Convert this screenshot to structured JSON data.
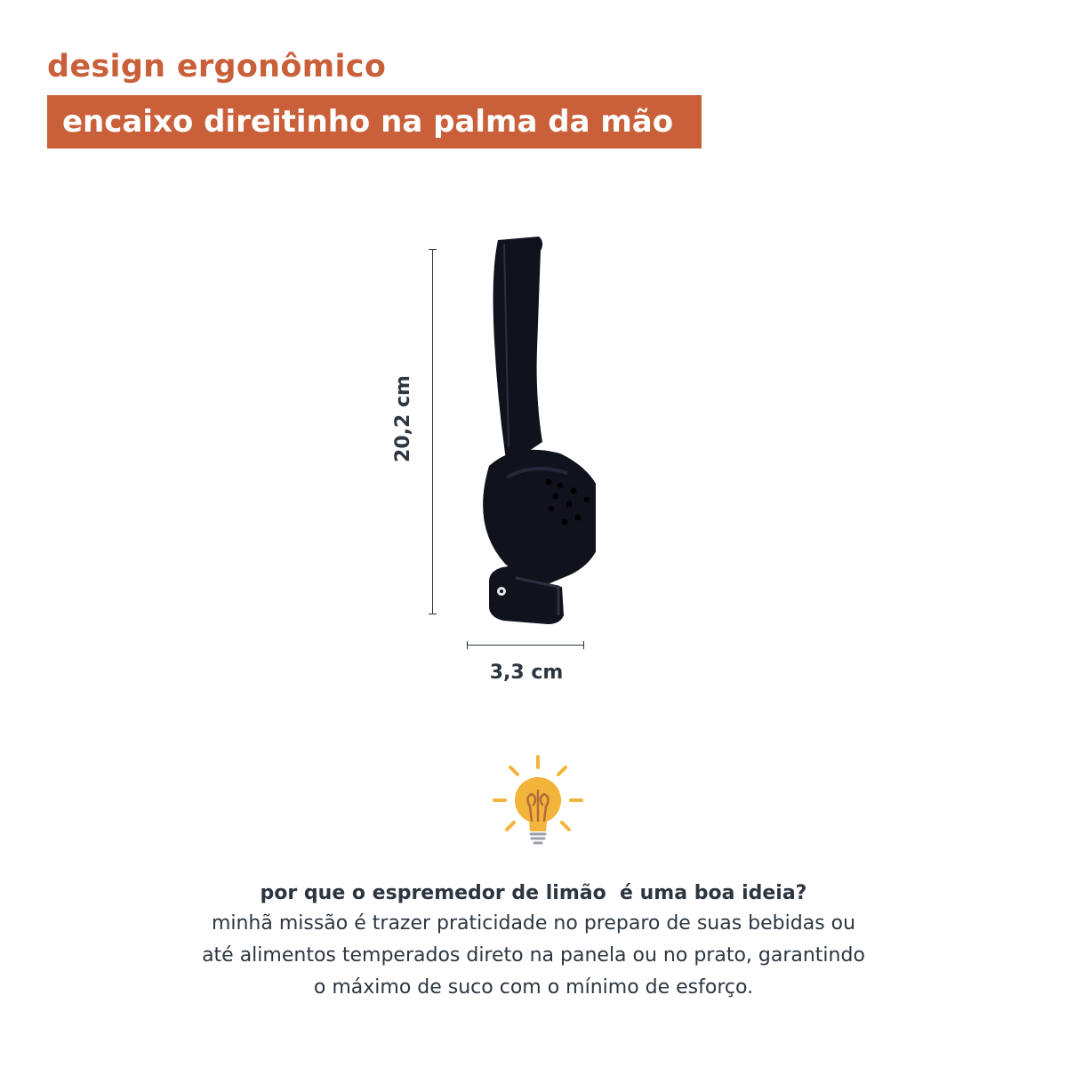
{
  "header": {
    "title": "design ergonômico",
    "subtitle": "encaixo direitinho na palma da mão"
  },
  "dimensions": {
    "height_label": "20,2 cm",
    "width_label": "3,3 cm"
  },
  "product": {
    "icon": "lemon-squeezer-image"
  },
  "tip": {
    "icon": "lightbulb-icon",
    "question": "por que o espremedor de limão  é uma boa ideia?",
    "lines": [
      "minhã missão é trazer praticidade no preparo de suas bebidas ou",
      "até alimentos temperados direto na panela ou no prato, garantindo",
      "o máximo de suco com o mínimo de esforço."
    ]
  },
  "colors": {
    "accent": "#c9603a",
    "text": "#2d3640",
    "bulb": "#f2b43a",
    "product": "#10131d"
  }
}
